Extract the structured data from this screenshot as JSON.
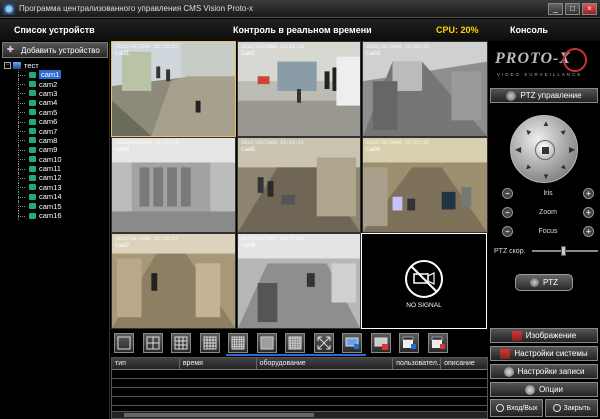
{
  "window": {
    "title": "Программа централизованного управления CMS Vision Proto-x",
    "buttons": [
      "_",
      "□",
      "×"
    ]
  },
  "header": {
    "devices_title": "Список устройств",
    "live_title": "Контроль в реальном времени",
    "cpu": "CPU: 20%",
    "console": "Консоль"
  },
  "sidebar": {
    "add_device": "Добавить устройство",
    "root": "тест",
    "cams": [
      "cam1",
      "cam2",
      "cam3",
      "cam4",
      "cam5",
      "cam6",
      "cam7",
      "cam8",
      "cam9",
      "cam10",
      "cam11",
      "cam12",
      "cam13",
      "cam14",
      "cam15",
      "cam16"
    ],
    "selected": "cam1"
  },
  "grid": {
    "cells": [
      {
        "name": "cam1",
        "ts": "2012/10/2006 15:23:22"
      },
      {
        "name": "cam2",
        "ts": "2012/10/2006 15:23:23"
      },
      {
        "name": "cam3",
        "ts": "2012/10/2006 15:23:22"
      },
      {
        "name": "cam4",
        "ts": "2012/10/2006 15:23:23"
      },
      {
        "name": "cam5",
        "ts": "2012/10/2006 15:23:21"
      },
      {
        "name": "cam6",
        "ts": "2012/10/2006 15:23:22"
      },
      {
        "name": "cam7",
        "ts": "2012/10/2006 15:23:22"
      },
      {
        "name": "cam8",
        "ts": "2012/10/2006 15:23:23"
      }
    ],
    "no_signal": "NO SIGNAL"
  },
  "layout_buttons": [
    {
      "name": "layout-1x1-button"
    },
    {
      "name": "layout-2x2-button"
    },
    {
      "name": "layout-3x3-button"
    },
    {
      "name": "layout-4x4-button"
    },
    {
      "name": "layout-5x5-button"
    },
    {
      "name": "layout-6x6-button"
    },
    {
      "name": "layout-7x7-button"
    },
    {
      "name": "fullscreen-button"
    },
    {
      "name": "snapshot-button"
    },
    {
      "name": "record-button"
    },
    {
      "name": "playback-button"
    },
    {
      "name": "stop-playback-button"
    }
  ],
  "events": {
    "columns": [
      "тип",
      "время",
      "оборудование",
      "пользовател...",
      "описание"
    ]
  },
  "right": {
    "logo": "PROTO-X",
    "logo_sub": "VIDEO SURVEILLANCE",
    "ptz_control": "PTZ управление",
    "iris": "Iris",
    "zoom": "Zoom",
    "focus": "Focus",
    "ptz_speed": "PTZ скор.",
    "ptz_speed_level": 0.45,
    "ptz_button": "PTZ",
    "image": "Изображение",
    "system_settings": "Настройки системы",
    "record_settings": "Настройки записи",
    "options": "Опции",
    "login": "Вход/Вых",
    "close": "Закрыть"
  },
  "colors": {
    "accent": "#2b6cd4",
    "cpu": "#ffd400",
    "active_border": "#e8c060"
  }
}
